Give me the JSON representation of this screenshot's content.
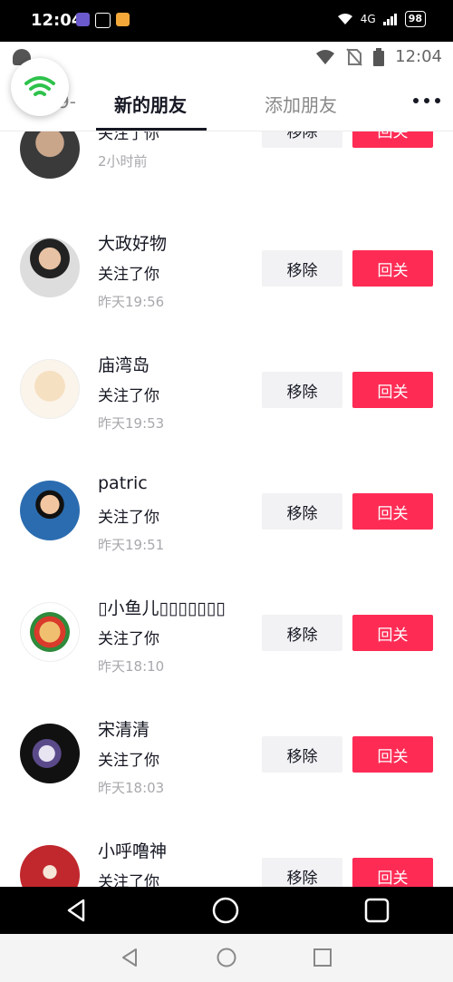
{
  "status_bar": {
    "time": "12:04",
    "network": "4G",
    "battery": "98"
  },
  "system_bar": {
    "time": "12:04"
  },
  "tabs": {
    "left_partial": "9-",
    "new_friends": "新的朋友",
    "add_friends": "添加朋友"
  },
  "colors": {
    "accent": "#fe2c55",
    "remove_bg": "#f2f2f4"
  },
  "rows": [
    {
      "name": "",
      "action": "关注了你",
      "time": "2小时前",
      "remove": "移除",
      "follow_back": "回关"
    },
    {
      "name": "大政好物",
      "action": "关注了你",
      "time": "昨天19:56",
      "remove": "移除",
      "follow_back": "回关"
    },
    {
      "name": "庙湾岛",
      "action": "关注了你",
      "time": "昨天19:53",
      "remove": "移除",
      "follow_back": "回关"
    },
    {
      "name": "patric",
      "action": "关注了你",
      "time": "昨天19:51",
      "remove": "移除",
      "follow_back": "回关"
    },
    {
      "name": "▯小鱼儿▯▯▯▯▯▯▯",
      "action": "关注了你",
      "time": "昨天18:10",
      "remove": "移除",
      "follow_back": "回关"
    },
    {
      "name": "宋清清",
      "action": "关注了你",
      "time": "昨天18:03",
      "remove": "移除",
      "follow_back": "回关"
    },
    {
      "name": "小呼噜神",
      "action": "关注了你",
      "time": "",
      "remove": "移除",
      "follow_back": "回关"
    }
  ]
}
